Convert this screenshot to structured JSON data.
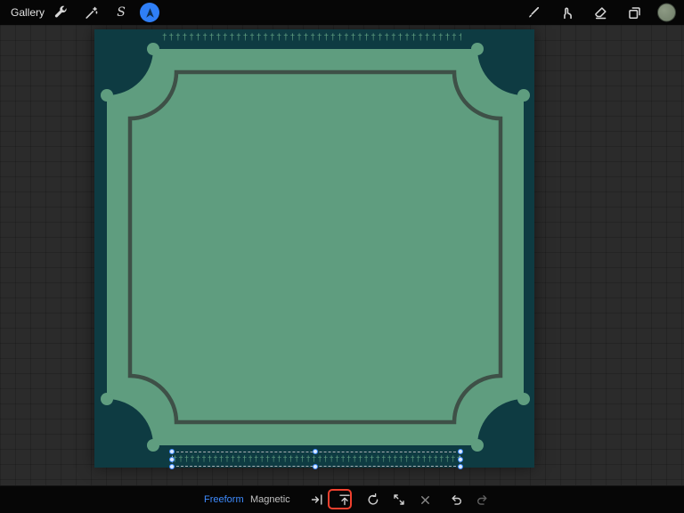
{
  "top_bar": {
    "gallery_label": "Gallery",
    "active_tool": "transform",
    "active_tool_color": "#2f7ff7",
    "left_icons": [
      "wrench",
      "adjustments",
      "selection",
      "transform"
    ],
    "right_icons": [
      "brush",
      "smudge",
      "eraser",
      "layers",
      "color-swatch"
    ],
    "color_swatch_color": "#7e8b76"
  },
  "canvas": {
    "background_color": "#0e3b42",
    "frame_fill_color": "#5f9d7f",
    "frame_outline_color": "#3e5047",
    "ornament_glyph": "†",
    "top_ornament_repeat": 60,
    "selection_ornament_repeat": 60
  },
  "selection": {
    "handle_ring_color": "#3d8bff",
    "handle_fill_color": "#dbe9ff",
    "dash_color": "#a9aeb3"
  },
  "bottom_bar": {
    "modes": [
      {
        "label": "Freeform",
        "active": true
      },
      {
        "label": "Magnetic",
        "active": false
      }
    ],
    "icons": [
      "flip-horizontal",
      "flip-vertical",
      "rotate-45",
      "fit-screen",
      "cancel",
      "undo",
      "redo"
    ],
    "highlighted_icon": "flip-vertical",
    "highlight_box_color": "#f0402e"
  }
}
